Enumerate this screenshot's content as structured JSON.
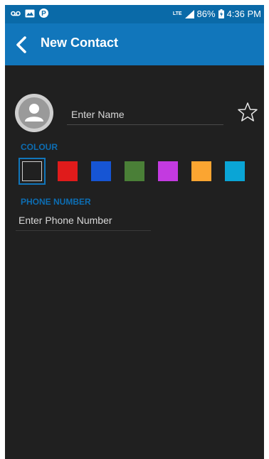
{
  "status_bar": {
    "network": "LTE",
    "battery": "86%",
    "time": "4:36 PM"
  },
  "app_bar": {
    "title": "New Contact"
  },
  "form": {
    "name_placeholder": "Enter Name",
    "colour_label": "COLOUR",
    "phone_label": "PHONE NUMBER",
    "phone_placeholder": "Enter Phone Number"
  },
  "colours": [
    {
      "name": "black",
      "hex": "#202020",
      "selected": true
    },
    {
      "name": "red",
      "hex": "#e01b1b",
      "selected": false
    },
    {
      "name": "blue",
      "hex": "#1655d4",
      "selected": false
    },
    {
      "name": "green",
      "hex": "#4a7f37",
      "selected": false
    },
    {
      "name": "purple",
      "hex": "#c33ae0",
      "selected": false
    },
    {
      "name": "orange",
      "hex": "#fba531",
      "selected": false
    },
    {
      "name": "cyan",
      "hex": "#0aa5d6",
      "selected": false
    }
  ],
  "theme": {
    "accent": "#1176bb",
    "background": "#202020"
  }
}
